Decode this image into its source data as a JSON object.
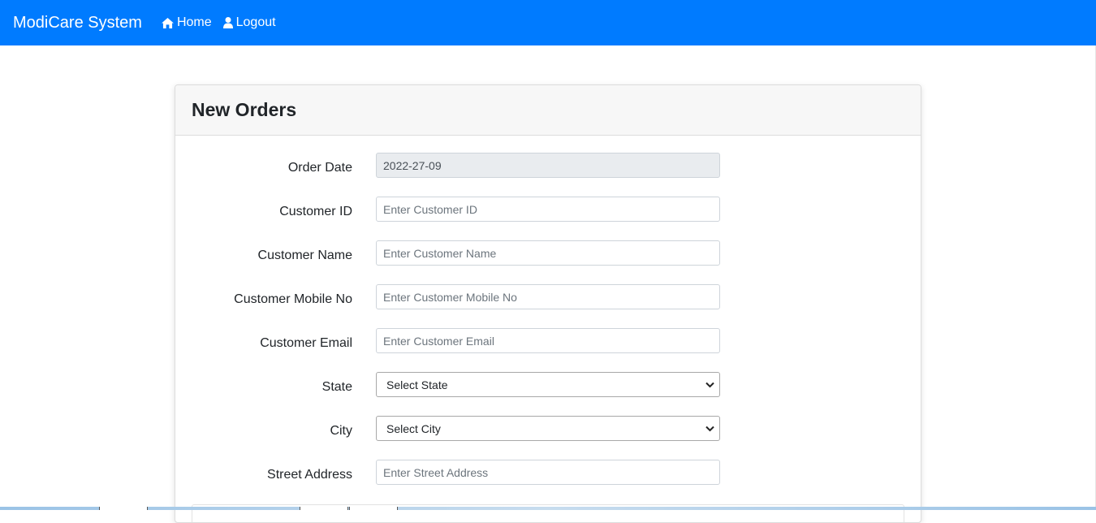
{
  "navbar": {
    "brand": "ModiCare System",
    "links": [
      {
        "label": "Home",
        "icon": "home-icon"
      },
      {
        "label": "Logout",
        "icon": "user-icon"
      }
    ],
    "background": "#007bff"
  },
  "card": {
    "title": "New Orders"
  },
  "form": {
    "order_date": {
      "label": "Order Date",
      "value": "2022-27-09"
    },
    "customer_id": {
      "label": "Customer ID",
      "placeholder": "Enter Customer ID"
    },
    "customer_name": {
      "label": "Customer Name",
      "placeholder": "Enter Customer Name"
    },
    "customer_mobile": {
      "label": "Customer Mobile No",
      "placeholder": "Enter Customer Mobile No"
    },
    "customer_email": {
      "label": "Customer Email",
      "placeholder": "Enter Customer Email"
    },
    "state": {
      "label": "State",
      "selected": "Select State"
    },
    "city": {
      "label": "City",
      "selected": "Select City"
    },
    "street_address": {
      "label": "Street Address",
      "placeholder": "Enter Street Address"
    }
  }
}
